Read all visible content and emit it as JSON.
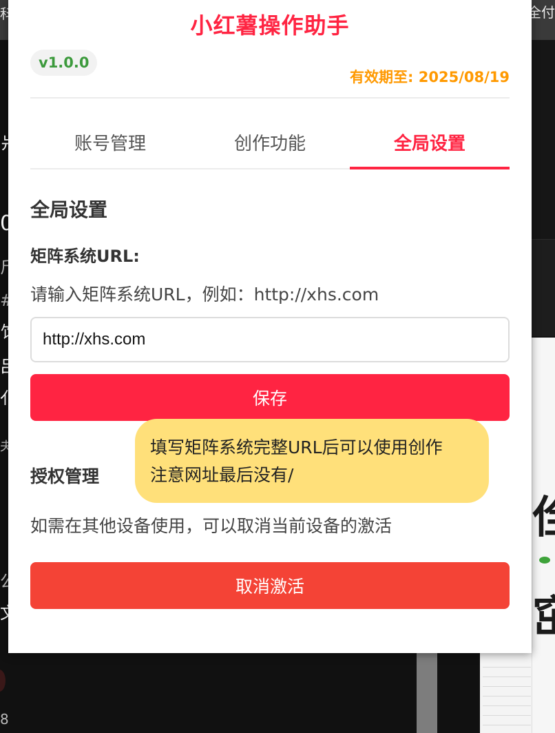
{
  "popup": {
    "title": "小红薯操作助手",
    "version": "v1.0.0",
    "expiry": "有效期至: 2025/08/19",
    "tabs": [
      {
        "label": "账号管理"
      },
      {
        "label": "创作功能"
      },
      {
        "label": "全局设置",
        "active": true
      }
    ],
    "section_title": "全局设置",
    "matrix_url": {
      "label": "矩阵系统URL:",
      "hint": "请输入矩阵系统URL，例如：http://xhs.com",
      "value": "http://xhs.com",
      "save_label": "保存"
    },
    "auth": {
      "title": "授权管理",
      "description": "如需在其他设备使用，可以取消当前设备的激活",
      "deactivate_label": "取消激活"
    }
  },
  "tooltip": {
    "line1": "填写矩阵系统完整URL后可以使用创作",
    "line2": "注意网址最后没有/"
  },
  "background": {
    "edge_left_top": "科",
    "edge_right_top": "全付",
    "left_fragments": [
      "爿",
      "0",
      "斤",
      "#",
      "饣",
      "吕",
      "亻",
      "夫",
      "公",
      "文",
      "8"
    ]
  },
  "colors": {
    "brand": "#ff2442",
    "danger": "#f44336",
    "version": "#3c9a3c",
    "expiry": "#ff9900",
    "tooltip": "#ffe07a"
  }
}
